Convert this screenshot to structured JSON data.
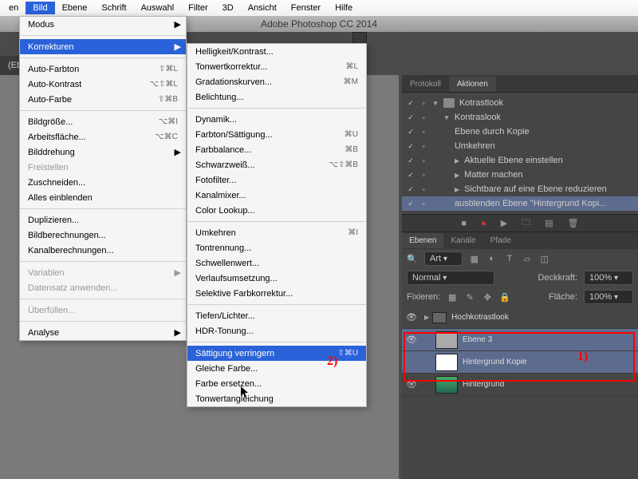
{
  "menubar": {
    "items": [
      "en",
      "Bild",
      "Ebene",
      "Schrift",
      "Auswahl",
      "Filter",
      "3D",
      "Ansicht",
      "Fenster",
      "Hilfe"
    ],
    "active": 1
  },
  "titlebar": "Adobe Photoshop CC 2014",
  "document_tab": "(Eb",
  "menu": [
    {
      "label": "Modus",
      "arrow": true
    },
    {
      "sep": true
    },
    {
      "label": "Korrekturen",
      "arrow": true,
      "hl": true
    },
    {
      "sep": true
    },
    {
      "label": "Auto-Farbton",
      "shortcut": "⇧⌘L"
    },
    {
      "label": "Auto-Kontrast",
      "shortcut": "⌥⇧⌘L"
    },
    {
      "label": "Auto-Farbe",
      "shortcut": "⇧⌘B"
    },
    {
      "sep": true
    },
    {
      "label": "Bildgröße...",
      "shortcut": "⌥⌘I"
    },
    {
      "label": "Arbeitsfläche...",
      "shortcut": "⌥⌘C"
    },
    {
      "label": "Bilddrehung",
      "arrow": true
    },
    {
      "label": "Freistellen",
      "disabled": true
    },
    {
      "label": "Zuschneiden..."
    },
    {
      "label": "Alles einblenden"
    },
    {
      "sep": true
    },
    {
      "label": "Duplizieren..."
    },
    {
      "label": "Bildberechnungen..."
    },
    {
      "label": "Kanalberechnungen..."
    },
    {
      "sep": true
    },
    {
      "label": "Variablen",
      "arrow": true,
      "disabled": true
    },
    {
      "label": "Datensatz anwenden...",
      "disabled": true
    },
    {
      "sep": true
    },
    {
      "label": "Überfüllen...",
      "disabled": true
    },
    {
      "sep": true
    },
    {
      "label": "Analyse",
      "arrow": true
    }
  ],
  "submenu": [
    {
      "label": "Helligkeit/Kontrast..."
    },
    {
      "label": "Tonwertkorrektur...",
      "shortcut": "⌘L"
    },
    {
      "label": "Gradationskurven...",
      "shortcut": "⌘M"
    },
    {
      "label": "Belichtung..."
    },
    {
      "sep": true
    },
    {
      "label": "Dynamik..."
    },
    {
      "label": "Farbton/Sättigung...",
      "shortcut": "⌘U"
    },
    {
      "label": "Farbbalance...",
      "shortcut": "⌘B"
    },
    {
      "label": "Schwarzweiß...",
      "shortcut": "⌥⇧⌘B"
    },
    {
      "label": "Fotofilter..."
    },
    {
      "label": "Kanalmixer..."
    },
    {
      "label": "Color Lookup..."
    },
    {
      "sep": true
    },
    {
      "label": "Umkehren",
      "shortcut": "⌘I"
    },
    {
      "label": "Tontrennung..."
    },
    {
      "label": "Schwellenwert..."
    },
    {
      "label": "Verlaufsumsetzung..."
    },
    {
      "label": "Selektive Farbkorrektur..."
    },
    {
      "sep": true
    },
    {
      "label": "Tiefen/Lichter..."
    },
    {
      "label": "HDR-Tonung..."
    },
    {
      "sep": true
    },
    {
      "label": "Sättigung verringern",
      "shortcut": "⇧⌘U",
      "hl": true
    },
    {
      "label": "Gleiche Farbe..."
    },
    {
      "label": "Farbe ersetzen..."
    },
    {
      "label": "Tonwertangleichung"
    }
  ],
  "panel_tabs": {
    "history": "Protokoll",
    "actions": "Aktionen"
  },
  "actions": [
    {
      "indent": 0,
      "tri": "▼",
      "folder": true,
      "label": "Kotrastlook"
    },
    {
      "indent": 1,
      "tri": "▼",
      "label": "Kontraslook"
    },
    {
      "indent": 2,
      "label": "Ebene durch Kopie"
    },
    {
      "indent": 2,
      "label": "Umkehren"
    },
    {
      "indent": 2,
      "tri": "▶",
      "label": "Aktuelle Ebene einstellen"
    },
    {
      "indent": 2,
      "tri": "▶",
      "label": "Matter machen"
    },
    {
      "indent": 2,
      "tri": "▶",
      "label": "Sichtbare auf eine Ebene reduzieren"
    },
    {
      "indent": 2,
      "label": "ausblenden Ebene \"Hintergrund Kopi...",
      "sel": true
    }
  ],
  "layers_tabs": {
    "layers": "Ebenen",
    "channels": "Kanäle",
    "paths": "Pfade"
  },
  "layer_kind": "Art",
  "blend_mode": "Normal",
  "opacity_label": "Deckkraft:",
  "opacity": "100%",
  "lock_label": "Fixieren:",
  "fill_label": "Fläche:",
  "fill": "100%",
  "layers": [
    {
      "vis": true,
      "group": true,
      "name": "Hochkotrastlook"
    },
    {
      "vis": true,
      "thumb": "gray",
      "name": "Ebene 3",
      "sel": true
    },
    {
      "vis": false,
      "thumb": "white",
      "name": "Hintergrund Kopie",
      "sel": true
    },
    {
      "vis": true,
      "thumb": "img",
      "name": "Hintergrund"
    }
  ],
  "annotations": {
    "one": "1)",
    "two": "2)"
  }
}
